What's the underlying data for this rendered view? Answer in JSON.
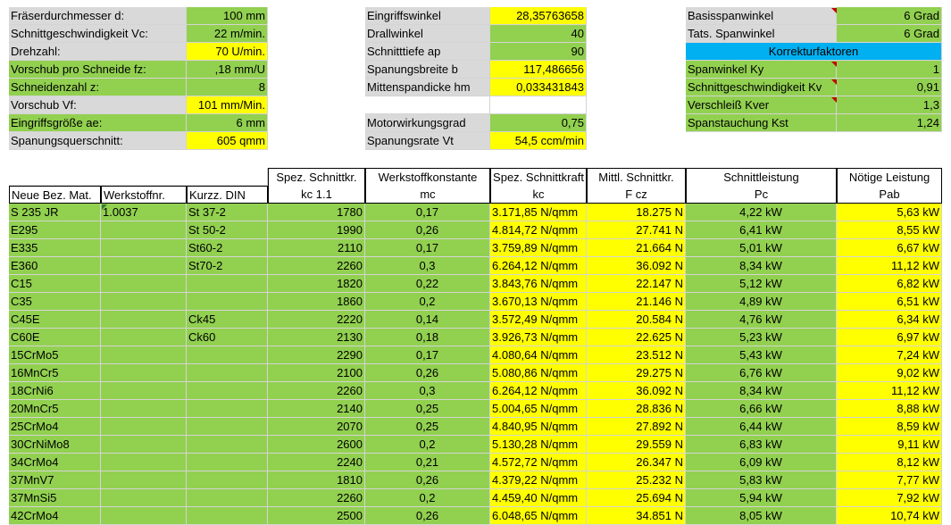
{
  "block1": [
    {
      "label": "Fräserdurchmesser d:",
      "value": "100 mm",
      "label_bg": "gray",
      "value_bg": "green"
    },
    {
      "label": "Schnittgeschwindigkeit Vc:",
      "value": "22 m/min.",
      "label_bg": "gray",
      "value_bg": "green"
    },
    {
      "label": "Drehzahl:",
      "value": "70 U/min.",
      "label_bg": "gray",
      "value_bg": "yellow"
    },
    {
      "label": "Vorschub pro Schneide fz:",
      "value": ",18 mm/U",
      "label_bg": "green",
      "value_bg": "green"
    },
    {
      "label": "Schneidenzahl z:",
      "value": "8",
      "label_bg": "green",
      "value_bg": "green"
    },
    {
      "label": "Vorschub Vf:",
      "value": "101 mm/Min.",
      "label_bg": "gray",
      "value_bg": "yellow"
    },
    {
      "label": "Eingriffsgröße ae:",
      "value": "6 mm",
      "label_bg": "green",
      "value_bg": "green"
    },
    {
      "label": "Spanungsquerschnitt:",
      "value": "605 qmm",
      "label_bg": "gray",
      "value_bg": "yellow"
    }
  ],
  "block2": [
    {
      "label": "Eingriffswinkel",
      "value": "28,35763658",
      "label_bg": "gray",
      "value_bg": "yellow"
    },
    {
      "label": "Drallwinkel",
      "value": "40",
      "label_bg": "gray",
      "value_bg": "green"
    },
    {
      "label": "Schnitttiefe ap",
      "value": "90",
      "label_bg": "gray",
      "value_bg": "green"
    },
    {
      "label": "Spanungsbreite b",
      "value": "117,486656",
      "label_bg": "gray",
      "value_bg": "yellow"
    },
    {
      "label": "Mittenspandicke hm",
      "value": "0,033431843",
      "label_bg": "gray",
      "value_bg": "yellow"
    },
    {
      "label": "",
      "value": "",
      "label_bg": "white",
      "value_bg": "white"
    },
    {
      "label": "Motorwirkungsgrad",
      "value": "0,75",
      "label_bg": "gray",
      "value_bg": "green"
    },
    {
      "label": "Spanungsrate Vt",
      "value": "54,5 ccm/min",
      "label_bg": "gray",
      "value_bg": "yellow"
    }
  ],
  "block3": [
    {
      "label": "Basisspanwinkel",
      "value": "6 Grad",
      "label_bg": "gray",
      "value_bg": "green"
    },
    {
      "label": "Tats. Spanwinkel",
      "value": "6 Grad",
      "label_bg": "gray",
      "value_bg": "green"
    },
    {
      "label": "Spanwinkel Ky",
      "value": "1",
      "label_bg": "green",
      "value_bg": "green"
    },
    {
      "label": "Schnittgeschwindigkeit Kv",
      "value": "0,91",
      "label_bg": "green",
      "value_bg": "green"
    },
    {
      "label": "Verschleiß Kver",
      "value": "1,3",
      "label_bg": "green",
      "value_bg": "green"
    },
    {
      "label": "Spanstauchung Kst",
      "value": "1,24",
      "label_bg": "green",
      "value_bg": "green"
    }
  ],
  "korrektur_label": "Korrekturfaktoren",
  "header_top": [
    "Spez. Schnittkr.",
    "Werkstoffkonstante",
    "Spez. Schnittkraft",
    "Mittl. Schnittkr.",
    "Schnittleistung",
    "Nötige Leistung"
  ],
  "header_bottom": [
    "Neue Bez. Mat.",
    "Werkstoffnr.",
    "Kurzz. DIN",
    "kc 1.1",
    "mc",
    "kc",
    "F cz",
    "Pc",
    "Pab"
  ],
  "rows": [
    [
      "S 235 JR",
      "1.0037",
      "St 37-2",
      "1780",
      "0,17",
      "3.171,85 N/qmm",
      "18.275 N",
      "4,22 kW",
      "5,63 kW"
    ],
    [
      "E295",
      "",
      "St 50-2",
      "1990",
      "0,26",
      "4.814,72 N/qmm",
      "27.741 N",
      "6,41 kW",
      "8,55 kW"
    ],
    [
      "E335",
      "",
      "St60-2",
      "2110",
      "0,17",
      "3.759,89 N/qmm",
      "21.664 N",
      "5,01 kW",
      "6,67 kW"
    ],
    [
      "E360",
      "",
      "St70-2",
      "2260",
      "0,3",
      "6.264,12 N/qmm",
      "36.092 N",
      "8,34 kW",
      "11,12 kW"
    ],
    [
      "C15",
      "",
      "",
      "1820",
      "0,22",
      "3.843,76 N/qmm",
      "22.147 N",
      "5,12 kW",
      "6,82 kW"
    ],
    [
      "C35",
      "",
      "",
      "1860",
      "0,2",
      "3.670,13 N/qmm",
      "21.146 N",
      "4,89 kW",
      "6,51 kW"
    ],
    [
      "C45E",
      "",
      "Ck45",
      "2220",
      "0,14",
      "3.572,49 N/qmm",
      "20.584 N",
      "4,76 kW",
      "6,34 kW"
    ],
    [
      "C60E",
      "",
      "Ck60",
      "2130",
      "0,18",
      "3.926,73 N/qmm",
      "22.625 N",
      "5,23 kW",
      "6,97 kW"
    ],
    [
      "15CrMo5",
      "",
      "",
      "2290",
      "0,17",
      "4.080,64 N/qmm",
      "23.512 N",
      "5,43 kW",
      "7,24 kW"
    ],
    [
      "16MnCr5",
      "",
      "",
      "2100",
      "0,26",
      "5.080,86 N/qmm",
      "29.275 N",
      "6,76 kW",
      "9,02 kW"
    ],
    [
      "18CrNi6",
      "",
      "",
      "2260",
      "0,3",
      "6.264,12 N/qmm",
      "36.092 N",
      "8,34 kW",
      "11,12 kW"
    ],
    [
      "20MnCr5",
      "",
      "",
      "2140",
      "0,25",
      "5.004,65 N/qmm",
      "28.836 N",
      "6,66 kW",
      "8,88 kW"
    ],
    [
      "25CrMo4",
      "",
      "",
      "2070",
      "0,25",
      "4.840,95 N/qmm",
      "27.892 N",
      "6,44 kW",
      "8,59 kW"
    ],
    [
      "30CrNiMo8",
      "",
      "",
      "2600",
      "0,2",
      "5.130,28 N/qmm",
      "29.559 N",
      "6,83 kW",
      "9,11 kW"
    ],
    [
      "34CrMo4",
      "",
      "",
      "2240",
      "0,21",
      "4.572,72 N/qmm",
      "26.347 N",
      "6,09 kW",
      "8,12 kW"
    ],
    [
      "37MnV7",
      "",
      "",
      "1810",
      "0,26",
      "4.379,22 N/qmm",
      "25.232 N",
      "5,83 kW",
      "7,77 kW"
    ],
    [
      "37MnSi5",
      "",
      "",
      "2260",
      "0,2",
      "4.459,40 N/qmm",
      "25.694 N",
      "5,94 kW",
      "7,92 kW"
    ],
    [
      "42CrMo4",
      "",
      "",
      "2500",
      "0,26",
      "6.048,65 N/qmm",
      "34.851 N",
      "8,05 kW",
      "10,74 kW"
    ]
  ],
  "colors": {
    "green": "#92d050",
    "yellow": "#ffff00",
    "gray": "#d9d9d9",
    "blue": "#00b0f0",
    "white": "#ffffff"
  }
}
